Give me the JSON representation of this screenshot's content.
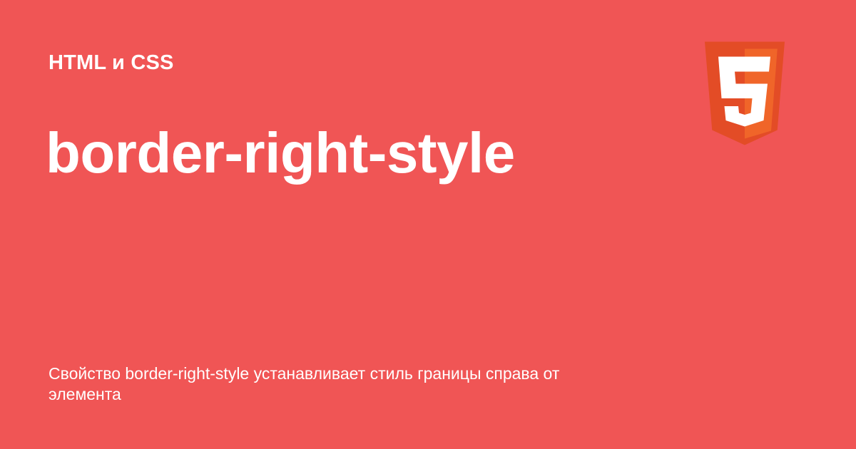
{
  "card": {
    "section_label": "HTML и CSS",
    "title": "border-right-style",
    "description": "Свойство border-right-style устанавливает стиль границы справа от элемента",
    "logo_icon": "html5-logo-icon",
    "logo_glyph": "5"
  },
  "colors": {
    "background": "#F05555",
    "text": "#FFFFFF",
    "logo_shield_dark": "#E34C26",
    "logo_shield_light": "#F06529",
    "logo_glyph": "#FFFFFF"
  }
}
